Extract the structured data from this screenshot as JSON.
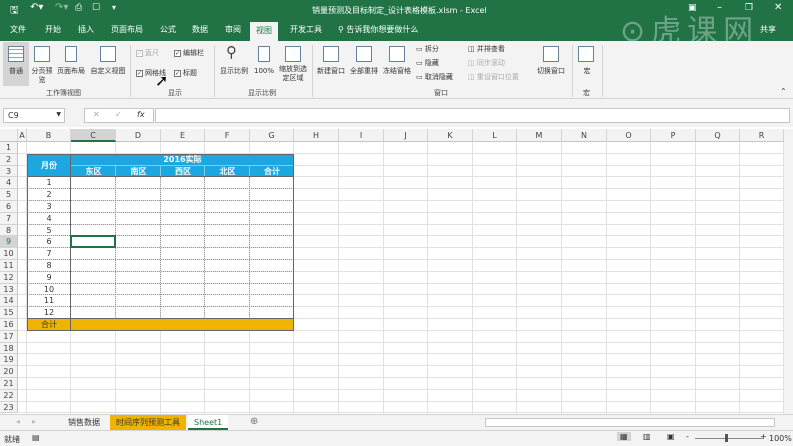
{
  "window": {
    "title": "销量预测及目标制定_设计表格模板.xlsm - Excel",
    "share": "共享",
    "watermark": "虎课网"
  },
  "tabs": [
    "文件",
    "开始",
    "插入",
    "页面布局",
    "公式",
    "数据",
    "审阅",
    "视图",
    "开发工具"
  ],
  "active_tab": "视图",
  "tell_me": "告诉我你想要做什么",
  "ribbon": {
    "workbook_views": {
      "label": "工作簿视图",
      "items": [
        "普通",
        "分页预览",
        "页面布局",
        "自定义视图"
      ]
    },
    "show": {
      "label": "显示",
      "ruler": "直尺",
      "formula_bar": "编辑栏",
      "gridlines": "网格线",
      "headings": "标题",
      "ruler_checked": true,
      "formula_bar_checked": true,
      "gridlines_checked": true,
      "headings_checked": true
    },
    "zoom": {
      "label": "显示比例",
      "items": [
        "显示比例",
        "100%",
        "缩放到选定区域"
      ]
    },
    "window": {
      "label": "窗口",
      "items": [
        "新建窗口",
        "全部重排",
        "冻结窗格"
      ],
      "split": "拆分",
      "hide": "隐藏",
      "unhide": "取消隐藏",
      "side_by_side": "并排查看",
      "sync_scroll": "同步滚动",
      "reset_pos": "重设窗口位置",
      "switch": "切换窗口"
    },
    "macros": {
      "label": "宏",
      "item": "宏"
    }
  },
  "formula_bar": {
    "name_box": "C9",
    "value": ""
  },
  "columns": [
    "A",
    "B",
    "C",
    "D",
    "E",
    "F",
    "G",
    "H",
    "I",
    "J",
    "K",
    "L",
    "M",
    "N",
    "O",
    "P",
    "Q",
    "R"
  ],
  "rows": [
    "1",
    "2",
    "3",
    "4",
    "5",
    "6",
    "7",
    "8",
    "9",
    "10",
    "11",
    "12",
    "13",
    "14",
    "15",
    "16",
    "17",
    "18",
    "19",
    "20",
    "21",
    "22",
    "23"
  ],
  "table": {
    "month_header": "月份",
    "group_header": "2016实际",
    "regions": [
      "东区",
      "南区",
      "西区",
      "北区",
      "合计"
    ],
    "months": [
      "1",
      "2",
      "3",
      "4",
      "5",
      "6",
      "7",
      "8",
      "9",
      "10",
      "11",
      "12"
    ],
    "total_label": "合计",
    "header_color": "#1ca7e0",
    "total_color": "#f0b400"
  },
  "selected_cell": "C9",
  "sheets": [
    {
      "name": "销售数据",
      "color": null
    },
    {
      "name": "时间序列预测工具",
      "color": "#f0b400"
    },
    {
      "name": "Sheet1",
      "active": true
    }
  ],
  "status": {
    "ready": "就绪",
    "zoom": "100%"
  }
}
